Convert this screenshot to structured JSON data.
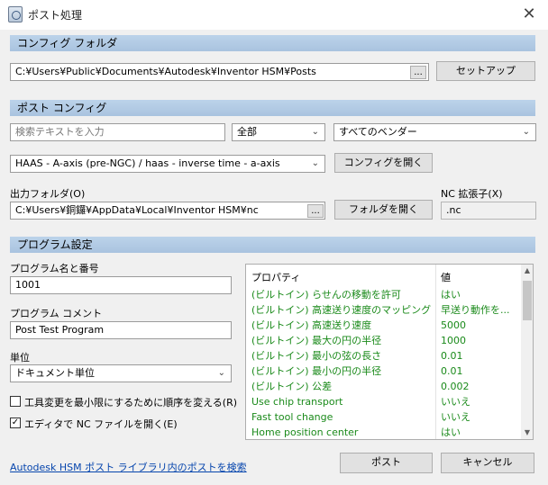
{
  "window": {
    "title": "ポスト処理",
    "close_glyph": "✕"
  },
  "config_folder": {
    "section_title": "コンフィグ フォルダ",
    "path": "C:¥Users¥Public¥Documents¥Autodesk¥Inventor HSM¥Posts",
    "browse_label": "...",
    "setup_label": "セットアップ"
  },
  "post_config": {
    "section_title": "ポスト コンフィグ",
    "search_placeholder": "検索テキストを入力",
    "filter_value": "全部",
    "vendor_value": "すべてのベンダー",
    "post_value": "HAAS - A-axis (pre-NGC) / haas - inverse time - a-axis",
    "open_config_label": "コンフィグを開く",
    "output_folder_label": "出力フォルダ(O)",
    "output_folder_path": "C:¥Users¥銅鑼¥AppData¥Local¥Inventor HSM¥nc",
    "output_browse_label": "...",
    "open_folder_label": "フォルダを開く",
    "nc_ext_label": "NC 拡張子(X)",
    "nc_ext_value": ".nc"
  },
  "program": {
    "section_title": "プログラム設定",
    "name_label": "プログラム名と番号",
    "name_value": "1001",
    "comment_label": "プログラム コメント",
    "comment_value": "Post Test Program",
    "unit_label": "単位",
    "unit_value": "ドキュメント単位",
    "reorder_label": "工具変更を最小限にするために順序を変える(R)",
    "reorder_checked": false,
    "open_nc_label": "エディタで NC ファイルを開く(E)",
    "open_nc_checked": true
  },
  "properties": {
    "header_name": "プロパティ",
    "header_value": "値",
    "rows": [
      {
        "name": "(ビルトイン) らせんの移動を許可",
        "value": "はい"
      },
      {
        "name": "(ビルトイン) 高速送り速度のマッピング",
        "value": "早送り動作を..."
      },
      {
        "name": "(ビルトイン) 高速送り速度",
        "value": "5000"
      },
      {
        "name": "(ビルトイン) 最大の円の半径",
        "value": "1000"
      },
      {
        "name": "(ビルトイン) 最小の弦の長さ",
        "value": "0.01"
      },
      {
        "name": "(ビルトイン) 最小の円の半径",
        "value": "0.01"
      },
      {
        "name": "(ビルトイン) 公差",
        "value": "0.002"
      },
      {
        "name": "Use chip transport",
        "value": "いいえ"
      },
      {
        "name": "Fast tool change",
        "value": "いいえ"
      },
      {
        "name": "Home position center",
        "value": "はい"
      }
    ]
  },
  "footer": {
    "library_link": "Autodesk HSM ポスト ライブラリ内のポストを検索",
    "post_button": "ポスト",
    "cancel_button": "キャンセル"
  },
  "colors": {
    "section_bar": "#b3cbe4",
    "property_text": "#1a8a1a",
    "link": "#0645ad"
  }
}
